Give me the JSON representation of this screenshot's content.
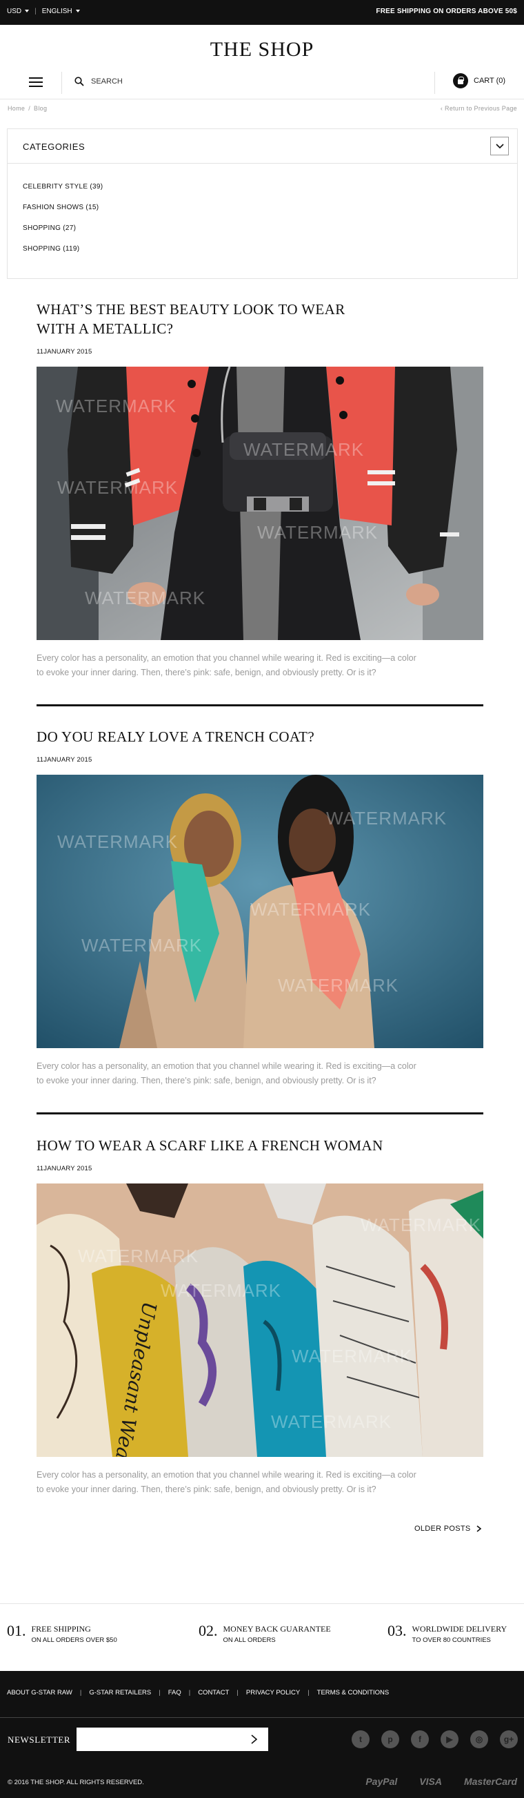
{
  "topbar": {
    "currency": "USD",
    "language": "ENGLISH",
    "shipping_notice": "FREE SHIPPING ON ORDERS ABOVE 50$"
  },
  "header": {
    "logo": "THE SHOP",
    "search_label": "SEARCH",
    "cart_label": "CART (0)"
  },
  "breadcrumb": {
    "items": [
      "Home",
      "Blog"
    ],
    "back_link": "Return to Previous Page"
  },
  "categories": {
    "title": "CATEGORIES",
    "items": [
      "CELEBRITY STYLE (39)",
      "FASHION SHOWS (15)",
      "SHOPPING (27)",
      "SHOPPING (119)"
    ]
  },
  "posts": [
    {
      "title_line1": "WHAT’S THE BEST BEAUTY LOOK TO WEAR",
      "title_line2": "WITH A METALLIC?",
      "date": "11JANUARY 2015",
      "excerpt_line1": "Every color has a personality, an emotion that you channel while wearing it. Red is exciting—a color",
      "excerpt_line2": "to evoke your inner daring. Then, there’s pink: safe, benign, and obviously pretty. Or is it?"
    },
    {
      "title_line1": "DO YOU REALY LOVE A TRENCH COAT?",
      "date": "11JANUARY 2015",
      "excerpt_line1": "Every color has a personality, an emotion that you channel while wearing it. Red is exciting—a color",
      "excerpt_line2": "to evoke your inner daring. Then, there’s pink: safe, benign, and obviously pretty. Or is it?"
    },
    {
      "title_line1": "HOW TO WEAR A SCARF LIKE A FRENCH WOMAN",
      "date": "11JANUARY 2015",
      "excerpt_line1": "Every color has a personality, an emotion that you channel while wearing it. Red is exciting—a color",
      "excerpt_line2": "to evoke your inner daring. Then, there’s pink: safe, benign, and obviously pretty. Or is it?"
    }
  ],
  "watermark": "WATERMARK",
  "scarf_script": "Unpleasant Weather",
  "pagination": {
    "older_label": "OLDER POSTS"
  },
  "features": [
    {
      "num": "01.",
      "title": "FREE SHIPPING",
      "subtitle": "ON ALL ORDERS OVER $50"
    },
    {
      "num": "02.",
      "title": "MONEY BACK GUARANTEE",
      "subtitle": "ON ALL ORDERS"
    },
    {
      "num": "03.",
      "title": "WORLDWIDE DELIVERY",
      "subtitle": "TO OVER 80 COUNTRIES"
    }
  ],
  "footer": {
    "links": [
      "ABOUT G-STAR RAW",
      "G-STAR RETAILERS",
      "FAQ",
      "CONTACT",
      "PRIVACY POLICY",
      "TERMS & CONDITIONS"
    ],
    "newsletter_label": "NEWSLETTER",
    "newsletter_value": "",
    "socials": [
      "twitter-icon",
      "pinterest-icon",
      "facebook-icon",
      "youtube-icon",
      "instagram-icon",
      "google-plus-icon"
    ],
    "copyright": "© 2016 THE SHOP. ALL RIGHTS RESERVED.",
    "payments": [
      "PayPal",
      "VISA",
      "MasterCard"
    ]
  },
  "colors": {
    "bar": "#111111",
    "text": "#111111",
    "muted": "#9a9a9a",
    "border": "#e3e3e3"
  }
}
